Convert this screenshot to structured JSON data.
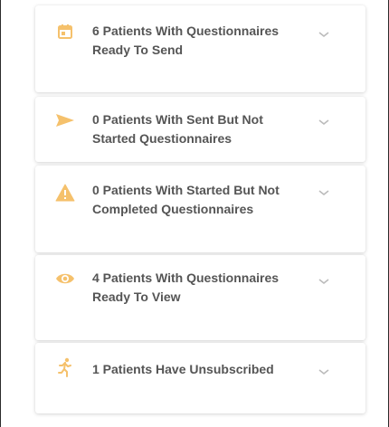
{
  "accent_color": "#f5c16c",
  "cards": [
    {
      "icon": "calendar-icon",
      "label": "6 Patients With Questionnaires Ready To Send"
    },
    {
      "icon": "send-icon",
      "label": "0 Patients With Sent But Not Started Questionnaires"
    },
    {
      "icon": "warning-icon",
      "label": "0 Patients With Started But Not Completed Questionnaires"
    },
    {
      "icon": "eye-icon",
      "label": "4 Patients With Questionnaires Ready To View"
    },
    {
      "icon": "running-person-icon",
      "label": "1 Patients Have Unsubscribed"
    }
  ]
}
